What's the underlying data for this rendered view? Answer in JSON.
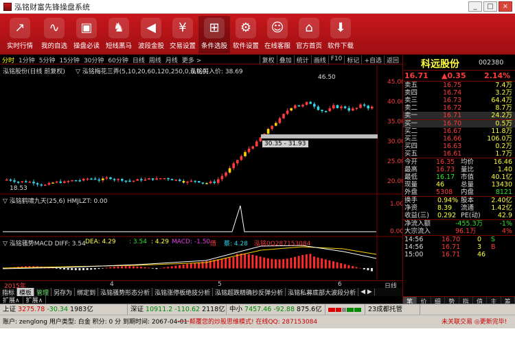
{
  "window": {
    "title": "泓铭财富先锋操盘系统",
    "buttons": [
      "_",
      "□",
      "×"
    ]
  },
  "toolbar": [
    {
      "label": "实时行情",
      "icon": "chart-line-icon",
      "glyph": "↗"
    },
    {
      "label": "我的自选",
      "icon": "pulse-icon",
      "glyph": "∿"
    },
    {
      "label": "操盘必读",
      "icon": "briefcase-icon",
      "glyph": "▣"
    },
    {
      "label": "短线黑马",
      "icon": "horse-icon",
      "glyph": "♞"
    },
    {
      "label": "波段金股",
      "icon": "speaker-icon",
      "glyph": "◀"
    },
    {
      "label": "交易设置",
      "icon": "yen-icon",
      "glyph": "¥"
    },
    {
      "label": "条件选股",
      "icon": "tree-icon",
      "glyph": "⊞"
    },
    {
      "label": "软件设置",
      "icon": "gear-box-icon",
      "glyph": "⚙"
    },
    {
      "label": "在线客服",
      "icon": "users-icon",
      "glyph": "☺"
    },
    {
      "label": "官方首页",
      "icon": "home-icon",
      "glyph": "⌂"
    },
    {
      "label": "软件下载",
      "icon": "download-icon",
      "glyph": "⬇"
    }
  ],
  "periods": [
    "分时",
    "1分钟",
    "5分钟",
    "15分钟",
    "30分钟",
    "60分钟",
    "日线",
    "周线",
    "月线",
    "更多 >"
  ],
  "selected_period": "分时",
  "period_buttons": [
    "复权",
    "叠加",
    "统计",
    "画线",
    "F10",
    "标记",
    "+自选",
    "返回"
  ],
  "chart_header": {
    "name": "泓铭股份(日线 前复权)",
    "indicator_label": "▽ 泓铭梅花三弄(5,10,20,60,120,250,0,0,0,0)",
    "buy_label": "泓铭买入价: 38.69"
  },
  "chart_annotations": {
    "high_label": "46.50",
    "low_label": "18.53",
    "gap_label": "30.35 - 31.93"
  },
  "y_axis": [
    "45.00",
    "40.00",
    "35.00",
    "30.00",
    "25.00",
    "20.00"
  ],
  "panel2": {
    "title": "▽ 泓铭鹤啸九天(25,6)  HMJLZT: 0.00",
    "axis": "1.00",
    "axis0": "0.00"
  },
  "panel3": {
    "title": "▽ 泓铭骚势MACD  DIFF: 3.54",
    "dea": "DEA: 4.29",
    "v1": ": 3.54",
    "v2": ": 4.29",
    "macd": "MACD: -1.50",
    "m1": "借",
    "m2": "蔡: 4.28",
    "m3": "泓铭0Q287153084"
  },
  "bottom": {
    "year": "2015年",
    "months": [
      "4",
      "5",
      "6"
    ],
    "tabs": [
      "指标",
      "模板",
      "管理",
      "另存为",
      "绑定到",
      "泓铭骚势形态分析",
      "泓铭涨停板绝技分析",
      "泓铭超跌精确抄反弹分析",
      "泓铭私募底部大波段分析"
    ],
    "arrows": "◀ ▶",
    "right_label": "日线",
    "tabs3": [
      "扩展∧",
      "扩展∧"
    ]
  },
  "quote": {
    "name": "科远股份",
    "code": "002380",
    "price": "16.71",
    "change": "▲0.35",
    "pct": "2.14%",
    "asks": [
      {
        "label": "卖五",
        "price": "16.75",
        "vol": "7.4万"
      },
      {
        "label": "卖四",
        "price": "16.74",
        "vol": "3.2万"
      },
      {
        "label": "卖三",
        "price": "16.73",
        "vol": "64.4万"
      },
      {
        "label": "卖二",
        "price": "16.72",
        "vol": "8.7万"
      },
      {
        "label": "卖一",
        "price": "16.71",
        "vol": "24.2万"
      }
    ],
    "bids": [
      {
        "label": "买一",
        "price": "16.70",
        "vol": "0.5万"
      },
      {
        "label": "买二",
        "price": "16.67",
        "vol": "11.8万"
      },
      {
        "label": "买三",
        "price": "16.66",
        "vol": "106.0万"
      },
      {
        "label": "买四",
        "price": "16.63",
        "vol": "0.2万"
      },
      {
        "label": "买五",
        "price": "16.61",
        "vol": "1.7万"
      }
    ],
    "stats1": [
      {
        "l": "今开",
        "v": "16.35",
        "l2": "均价",
        "v2": "16.46"
      },
      {
        "l": "最高",
        "v": "16.73",
        "l2": "量比",
        "v2": "1.40"
      },
      {
        "l": "最低",
        "v": "16.17",
        "l2": "市值",
        "v2": "40.1亿"
      },
      {
        "l": "现量",
        "v": "46",
        "l2": "总量",
        "v2": "13430"
      },
      {
        "l": "外盘",
        "v": "5308",
        "l2": "内盘",
        "v2": "8121"
      }
    ],
    "stats2": [
      {
        "l": "换手",
        "v": "0.94%",
        "l2": "股本",
        "v2": "2.40亿"
      },
      {
        "l": "净资",
        "v": "8.39",
        "l2": "流通",
        "v2": "1.42亿"
      },
      {
        "l": "收益(三)",
        "v": "0.292",
        "l2": "PE(动)",
        "v2": "42.9"
      }
    ],
    "flows": [
      {
        "l": "净流入额",
        "v": "-455.3万",
        "v2": "-1%"
      },
      {
        "l": "大宗流入",
        "v": "96.1万",
        "v2": "4%"
      }
    ],
    "ticks": [
      {
        "t": "14:56",
        "p": "16.70",
        "v": "0",
        "s": "S"
      },
      {
        "t": "14:56",
        "p": "16.71",
        "v": "3",
        "s": "B"
      },
      {
        "t": "15:00",
        "p": "16.71",
        "v": "46",
        "s": ""
      }
    ],
    "tabs": [
      "笔",
      "价",
      "细",
      "势",
      "指",
      "值",
      "主",
      "筹"
    ]
  },
  "status1": [
    {
      "label": "上证",
      "value": "3275.78",
      "chg": "-30.34",
      "amt": "1983亿"
    },
    {
      "label": "深证",
      "value": "10911.2",
      "chg": "-110.62",
      "amt": "2118亿"
    },
    {
      "label": "中小",
      "value": "7457.46",
      "chg": "-92.88",
      "amt": "875.6亿"
    }
  ],
  "status1_extra": "23成都托管",
  "status2": {
    "account": "账户: zenglong 用户类型: 白金  积分: 0 分  到期时间: 2067-04-01",
    "marquee": "一一颠覆您的炒股思维模式!  在线QQ: 287153084",
    "right": "未关联交易 ◎更新完毕!"
  }
}
